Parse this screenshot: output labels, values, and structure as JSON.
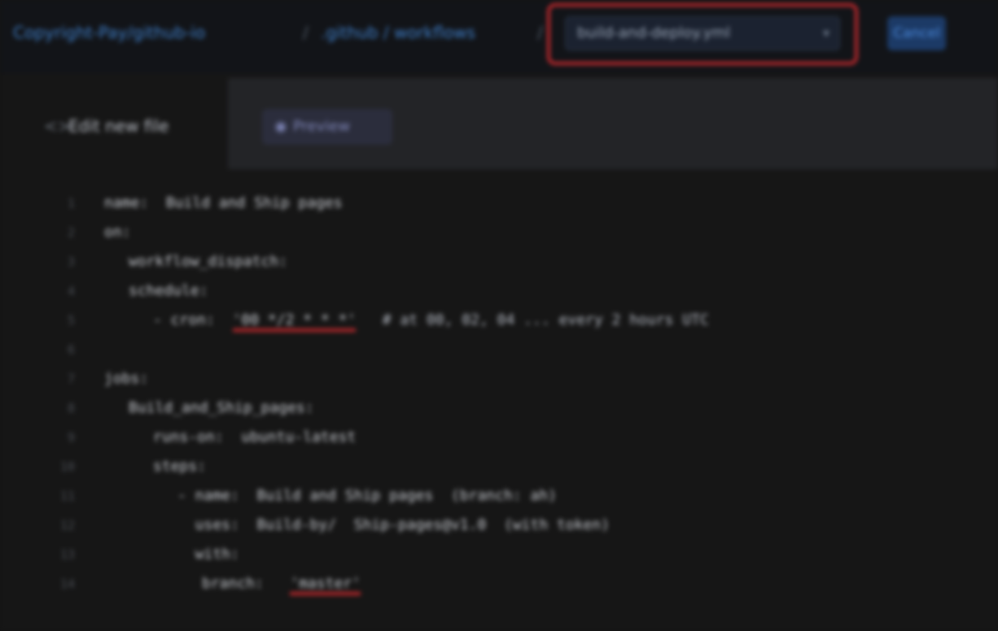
{
  "breadcrumb": {
    "repo": "Copyright-Pay/github-io",
    "separator": "/",
    "path": ".github / workflows",
    "filename": "build-and-deploy.yml",
    "cancel_label": "Cancel"
  },
  "tabs": {
    "edit_label": "Edit new file",
    "preview_label": "Preview"
  },
  "code_lines": [
    {
      "n": "1",
      "indent": 0,
      "text": "name:  Build and Ship pages"
    },
    {
      "n": "2",
      "indent": 0,
      "text": "on:"
    },
    {
      "n": "3",
      "indent": 1,
      "text": "workflow_dispatch:"
    },
    {
      "n": "4",
      "indent": 1,
      "text": "schedule:"
    },
    {
      "n": "5",
      "indent": 2,
      "pre": "- cron:  ",
      "err": "'00 */2 * * *'",
      "post": "   # at 00, 02, 04 ... every 2 hours UTC"
    },
    {
      "n": "6",
      "indent": 0,
      "text": ""
    },
    {
      "n": "7",
      "indent": 0,
      "text": "jobs:"
    },
    {
      "n": "8",
      "indent": 1,
      "text": "Build_and_Ship_pages:"
    },
    {
      "n": "9",
      "indent": 2,
      "text": "runs-on:  ubuntu-latest"
    },
    {
      "n": "10",
      "indent": 2,
      "text": "steps:"
    },
    {
      "n": "11",
      "indent": 3,
      "text": "- name:  Build and Ship pages  (branch: ah)"
    },
    {
      "n": "12",
      "indent": 3,
      "text": "  uses:  Build-by/  Ship-pages@v1.0  (with token)"
    },
    {
      "n": "13",
      "indent": 3,
      "text": "  with:"
    },
    {
      "n": "14",
      "indent": 4,
      "pre": "branch:   ",
      "err": "'master'",
      "post": ""
    }
  ]
}
